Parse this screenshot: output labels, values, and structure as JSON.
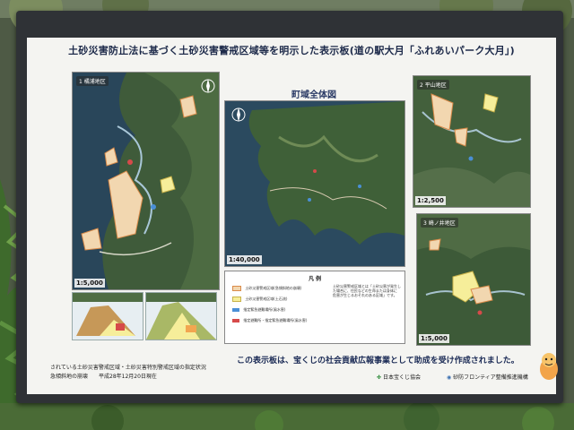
{
  "board": {
    "title": "土砂災害防止法に基づく土砂災害警戒区域等を明示した表示板(道の駅大月「ふれあいパーク大月」)"
  },
  "panels": {
    "map1": {
      "label": "1 橘浦地区",
      "scale": "1:5,000"
    },
    "overview": {
      "title": "町域全体図",
      "scale": "1:40,000"
    },
    "map2": {
      "label": "2 平山地区",
      "scale": "1:2,500"
    },
    "map3": {
      "label": "3 崎ノ井地区",
      "scale": "1:5,000"
    }
  },
  "legend": {
    "title": "凡 例",
    "items": [
      {
        "label": "土砂災害警戒区域(急傾斜地の崩壊)",
        "color": "#f2d7b0"
      },
      {
        "label": "土砂災害警戒区域(土石流)",
        "color": "#f6ee9a"
      },
      {
        "label": "指定緊急避難場所(風水害)",
        "color": "#4a8fd6"
      },
      {
        "label": "指定避難所・指定緊急避難場所(風水害)",
        "color": "#d64a4a"
      }
    ],
    "notes": [
      "土砂災害警戒区域とは「土砂災害が発生した場合に、住民などの生命または身体に",
      "危害が生じるおそれのある区域」です。"
    ]
  },
  "footer": {
    "line1": "されている土砂災害警戒区域・土砂災害特別警戒区域の指定状況",
    "line2": "急傾斜地の崩壊　　平成28年12月20日現在",
    "main": "この表示板は、宝くじの社会貢献広報事業として助成を受け作成されました。",
    "sponsor1": "日本宝くじ協会",
    "sponsor2": "砂防フロンティア整備推進機構"
  },
  "colors": {
    "board_bg": "#f4f4f1",
    "frame": "#2f3236",
    "title_text": "#1d2a4a",
    "hazard_steep": "#f2d7b0",
    "hazard_debris": "#f6ee9a"
  }
}
